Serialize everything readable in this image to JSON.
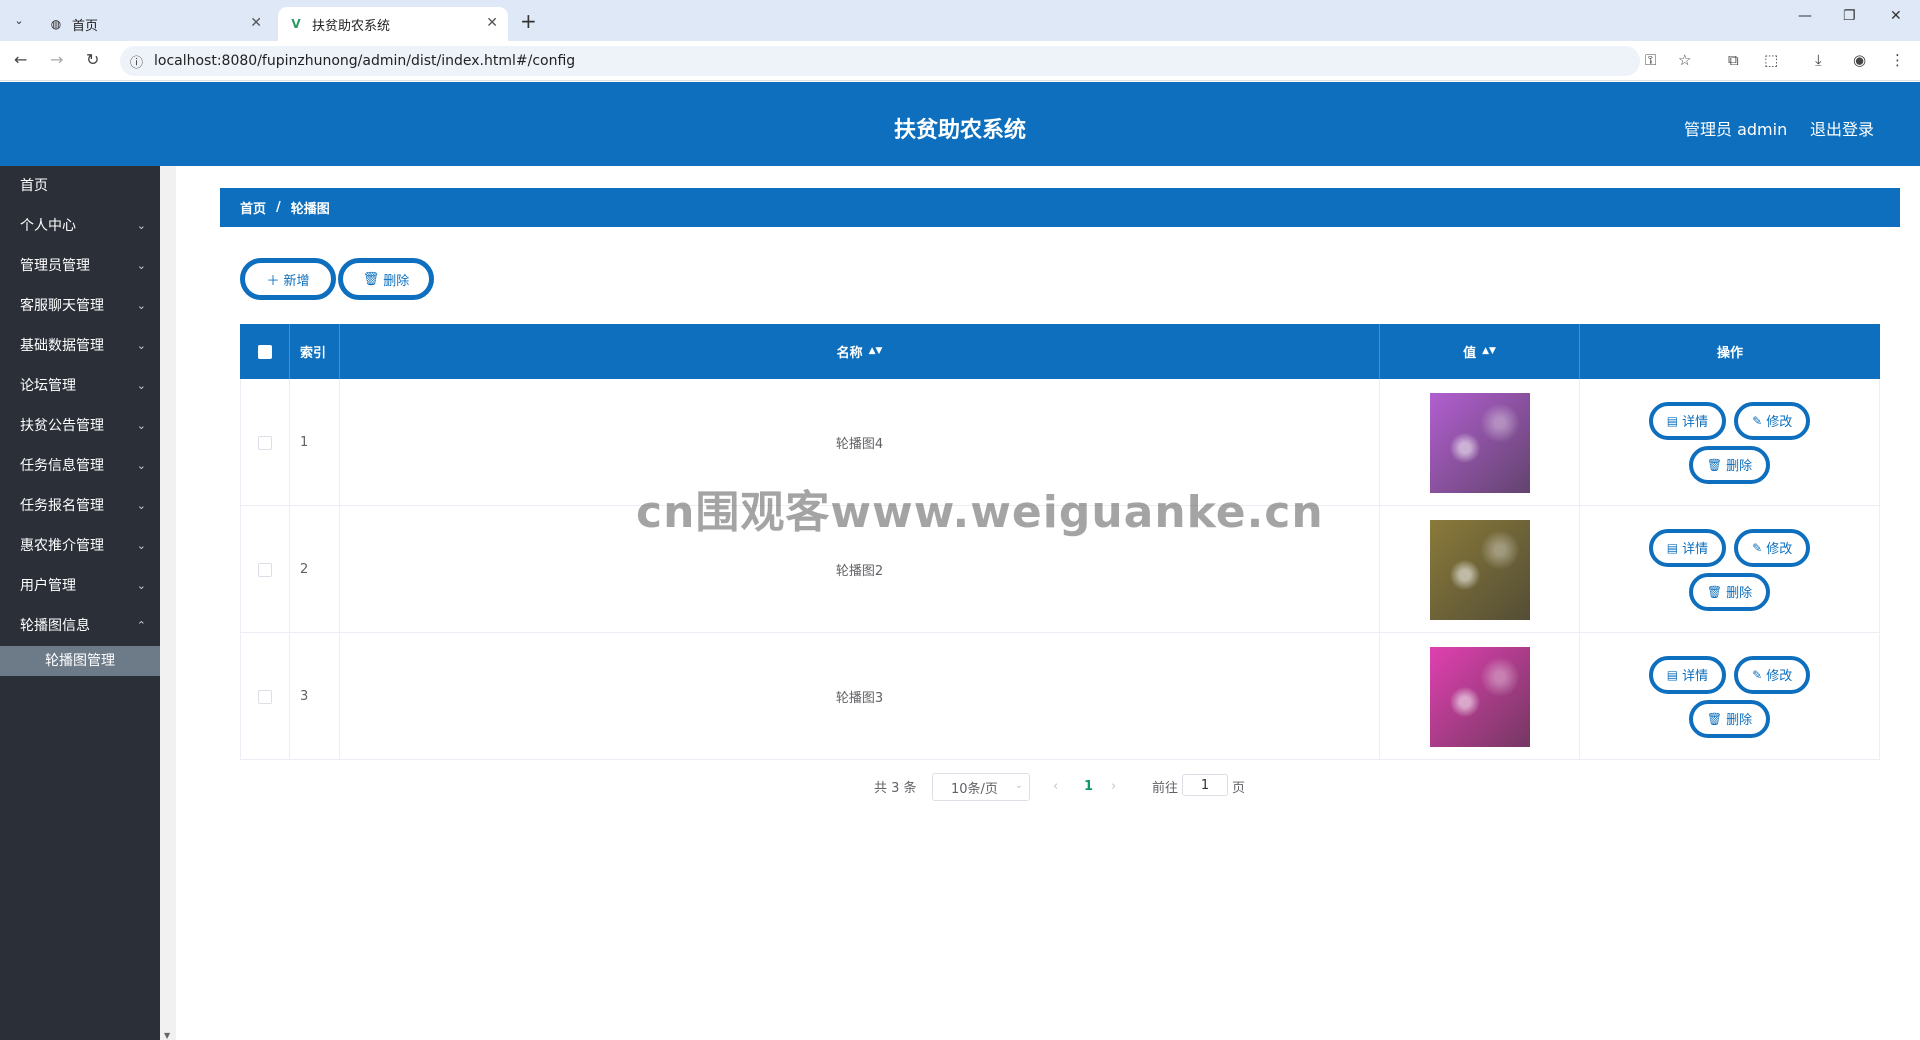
{
  "browser": {
    "tabs": [
      {
        "label": "首页"
      },
      {
        "label": "扶贫助农系统"
      }
    ],
    "url": "localhost:8080/fupinzhunong/admin/dist/index.html#/config"
  },
  "header": {
    "title": "扶贫助农系统",
    "user": "管理员 admin",
    "logout": "退出登录"
  },
  "sidebar": {
    "items": [
      {
        "label": "首页"
      },
      {
        "label": "个人中心"
      },
      {
        "label": "管理员管理"
      },
      {
        "label": "客服聊天管理"
      },
      {
        "label": "基础数据管理"
      },
      {
        "label": "论坛管理"
      },
      {
        "label": "扶贫公告管理"
      },
      {
        "label": "任务信息管理"
      },
      {
        "label": "任务报名管理"
      },
      {
        "label": "惠农推介管理"
      },
      {
        "label": "用户管理"
      },
      {
        "label": "轮播图信息"
      }
    ],
    "sub_item": "轮播图管理"
  },
  "breadcrumb": {
    "home": "首页",
    "sep": "/",
    "current": "轮播图"
  },
  "toolbar": {
    "add": "新增",
    "delete": "删除"
  },
  "table": {
    "headers": {
      "index": "索引",
      "name": "名称",
      "value": "值",
      "actions": "操作"
    },
    "rows": [
      {
        "index": "1",
        "name": "轮播图4",
        "thumb_color": "#b25fd0"
      },
      {
        "index": "2",
        "name": "轮播图2",
        "thumb_color": "#8a7a3a"
      },
      {
        "index": "3",
        "name": "轮播图3",
        "thumb_color": "#e040b0"
      }
    ],
    "actions": {
      "detail": "详情",
      "edit": "修改",
      "delete": "删除"
    }
  },
  "pagination": {
    "total": "共 3 条",
    "page_size": "10条/页",
    "current": "1",
    "goto_prefix": "前往",
    "goto_value": "1",
    "goto_suffix": "页"
  },
  "watermark": "cn围观客www.weiguanke.cn",
  "colors": {
    "primary": "#0d6fbd",
    "sidebar": "#2b3038"
  }
}
